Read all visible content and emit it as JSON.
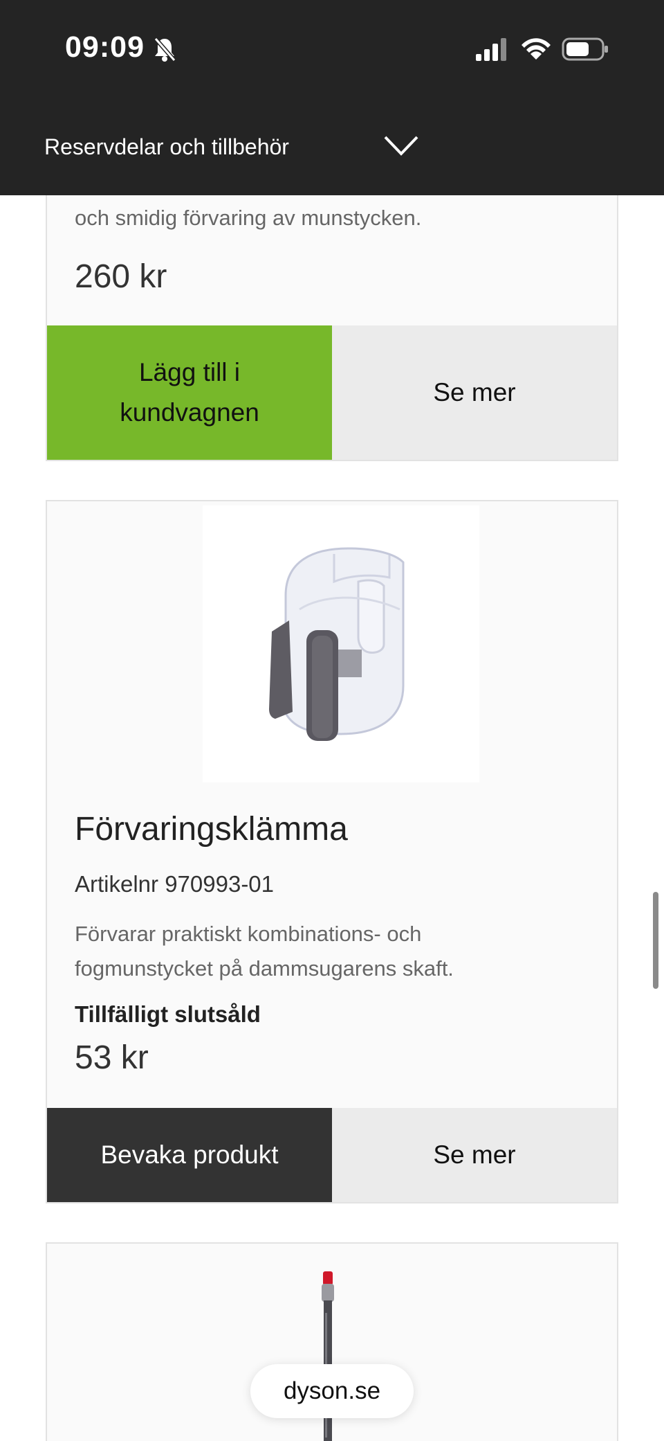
{
  "status_bar": {
    "time": "09:09"
  },
  "nav": {
    "title": "Reservdelar och tillbehör"
  },
  "cards": [
    {
      "desc_line": "och smidig förvaring av munstycken.",
      "price": "260 kr",
      "primary_button": "Lägg till i\nkundvagnen",
      "secondary_button": "Se mer"
    },
    {
      "title": "Förvaringsklämma",
      "article_number": "Artikelnr 970993-01",
      "description": "Förvarar praktiskt kombinations- och fogmunstycket på dammsugarens skaft.",
      "stock_status": "Tillfälligt slutsåld",
      "price": "53 kr",
      "primary_button": "Bevaka produkt",
      "secondary_button": "Se mer"
    }
  ],
  "browser": {
    "url": "dyson.se"
  },
  "colors": {
    "header_bg": "#242424",
    "add_to_cart": "#77b82a",
    "watch_button": "#333333",
    "secondary_button": "#ebebeb"
  }
}
